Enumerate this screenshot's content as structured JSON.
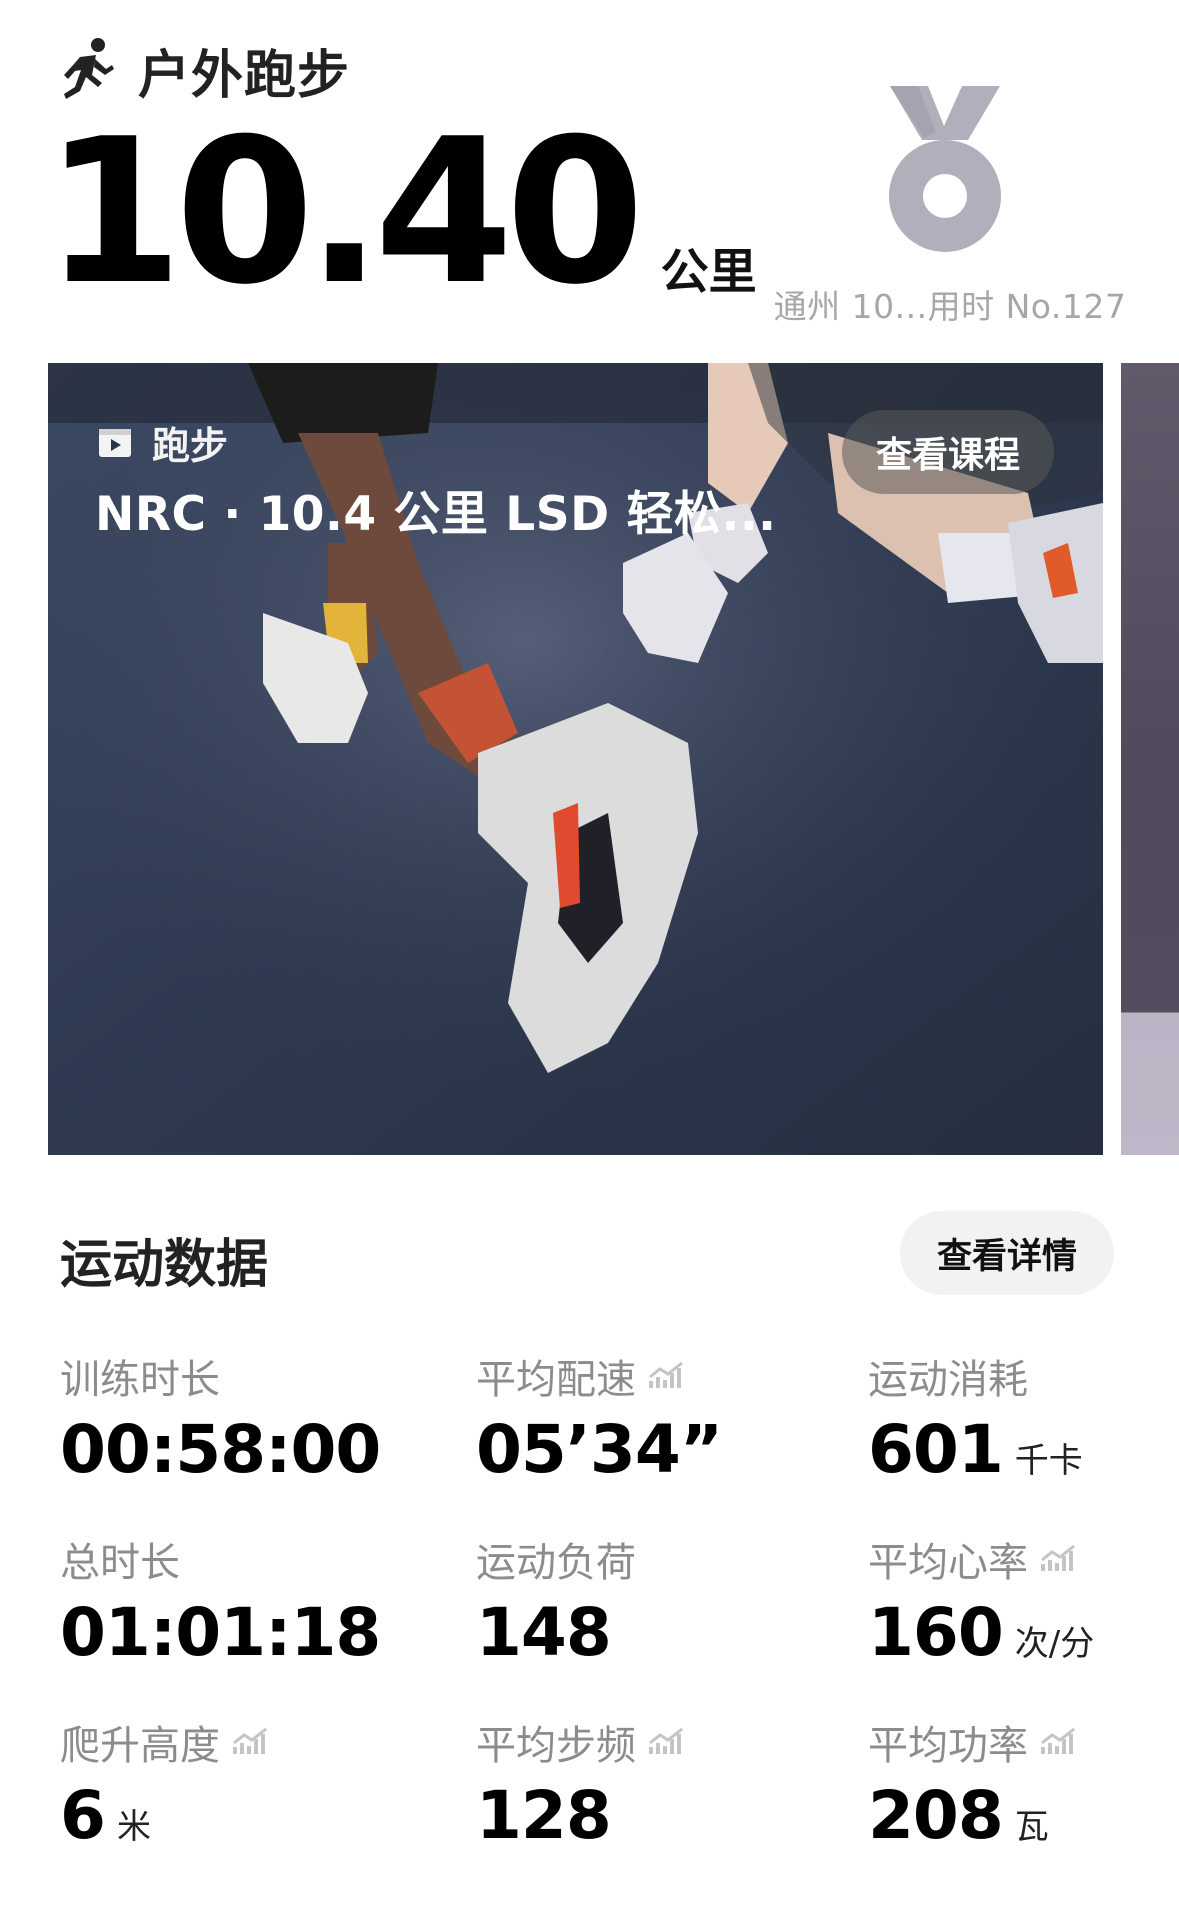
{
  "header": {
    "sport_icon": "running-person-icon",
    "sport_name": "户外跑步",
    "distance_value": "10.40",
    "distance_unit": "公里",
    "medal_icon": "medal-icon",
    "medal_caption": "通州 10...用时 No.127"
  },
  "course_card": {
    "type_icon": "video-play-icon",
    "type_label": "跑步",
    "title": "NRC · 10.4 公里 LSD 轻松...",
    "view_course_label": "查看课程"
  },
  "sport_data": {
    "title": "运动数据",
    "details_label": "查看详情",
    "trend_icon": "chart-trend-icon",
    "stats": [
      {
        "label": "训练时长",
        "value": "00:58:00",
        "unit": "",
        "has_trend": false
      },
      {
        "label": "平均配速",
        "value": "05’34”",
        "unit": "",
        "has_trend": true
      },
      {
        "label": "运动消耗",
        "value": "601",
        "unit": "千卡",
        "has_trend": false
      },
      {
        "label": "总时长",
        "value": "01:01:18",
        "unit": "",
        "has_trend": false
      },
      {
        "label": "运动负荷",
        "value": "148",
        "unit": "",
        "has_trend": false
      },
      {
        "label": "平均心率",
        "value": "160",
        "unit": "次/分",
        "has_trend": true
      },
      {
        "label": "爬升高度",
        "value": "6",
        "unit": "米",
        "has_trend": true
      },
      {
        "label": "平均步频",
        "value": "128",
        "unit": "",
        "has_trend": true
      },
      {
        "label": "平均功率",
        "value": "208",
        "unit": "瓦",
        "has_trend": true
      }
    ]
  },
  "colors": {
    "medal": "#b3aebb",
    "caption_gray": "#a7a7a7",
    "label_gray": "#8c8c8c",
    "button_bg": "#f2f2f2"
  }
}
